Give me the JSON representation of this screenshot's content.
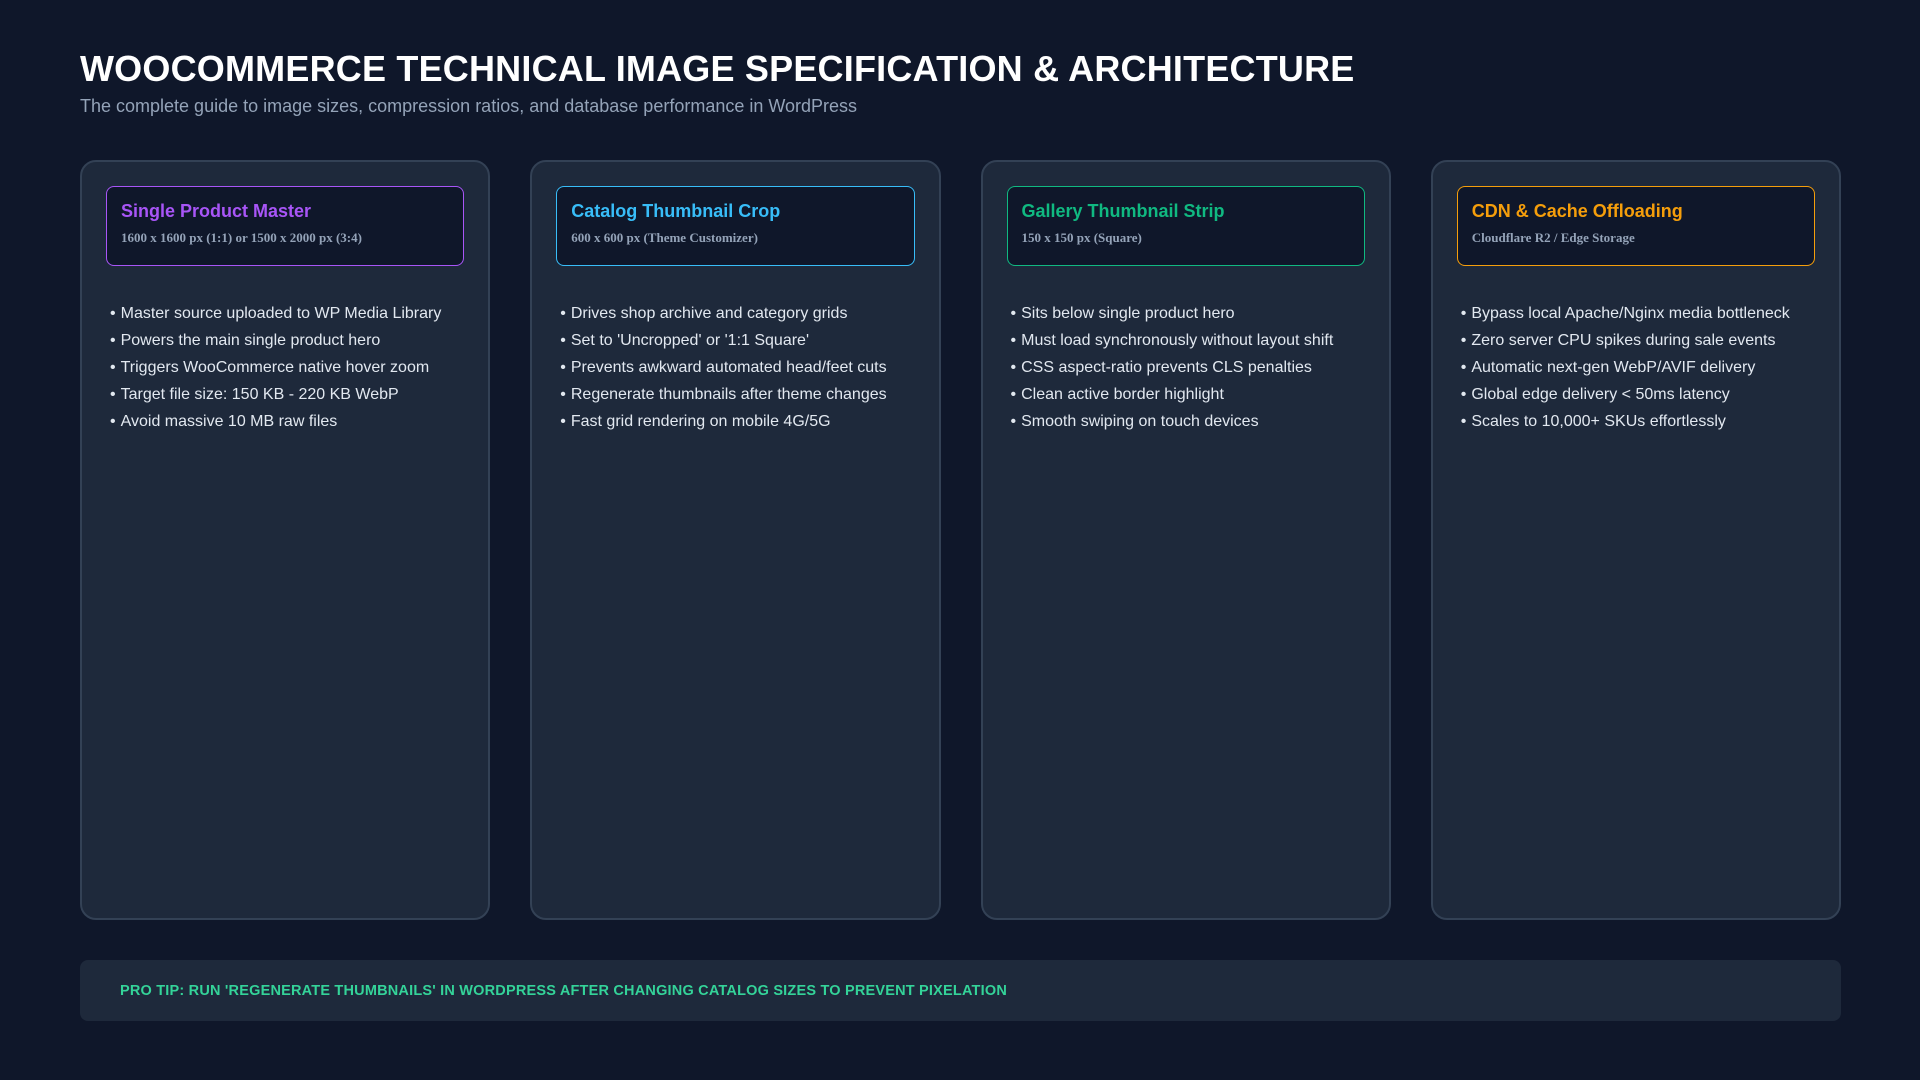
{
  "header": {
    "title": "WOOCOMMERCE TECHNICAL IMAGE SPECIFICATION & ARCHITECTURE",
    "subtitle": "The complete guide to image sizes, compression ratios, and database performance in WordPress"
  },
  "cards": [
    {
      "title": "Single Product Master",
      "spec": "1600 x 1600 px (1:1) or 1500 x 2000 px (3:4)",
      "accent": "#a855f7",
      "bullets": [
        "Master source uploaded to WP Media Library",
        "Powers the main single product hero",
        "Triggers WooCommerce native hover zoom",
        "Target file size: 150 KB - 220 KB WebP",
        "Avoid massive 10 MB raw files"
      ]
    },
    {
      "title": "Catalog Thumbnail Crop",
      "spec": "600 x 600 px (Theme Customizer)",
      "accent": "#38bdf8",
      "bullets": [
        "Drives shop archive and category grids",
        "Set to 'Uncropped' or '1:1 Square'",
        "Prevents awkward automated head/feet cuts",
        "Regenerate thumbnails after theme changes",
        "Fast grid rendering on mobile 4G/5G"
      ]
    },
    {
      "title": "Gallery Thumbnail Strip",
      "spec": "150 x 150 px (Square)",
      "accent": "#10b981",
      "bullets": [
        "Sits below single product hero",
        "Must load synchronously without layout shift",
        "CSS aspect-ratio prevents CLS penalties",
        "Clean active border highlight",
        "Smooth swiping on touch devices"
      ]
    },
    {
      "title": "CDN & Cache Offloading",
      "spec": "Cloudflare R2 / Edge Storage",
      "accent": "#f59e0b",
      "bullets": [
        "Bypass local Apache/Nginx media bottleneck",
        "Zero server CPU spikes during sale events",
        "Automatic next-gen WebP/AVIF delivery",
        "Global edge delivery < 50ms latency",
        "Scales to 10,000+ SKUs effortlessly"
      ]
    }
  ],
  "footer": {
    "tip": "PRO TIP: RUN 'REGENERATE THUMBNAILS' IN WORDPRESS AFTER CHANGING CATALOG SIZES TO PREVENT PIXELATION"
  }
}
